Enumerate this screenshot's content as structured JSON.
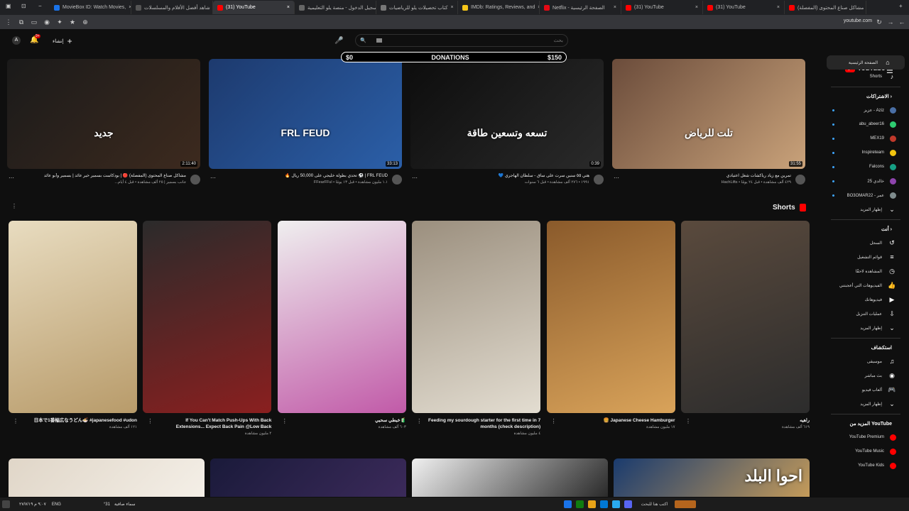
{
  "browser": {
    "tabs": [
      {
        "label": "MovieBox ID: Watch Movies,",
        "color": "#1a73e8"
      },
      {
        "label": "شاهد أفضل الأفلام والمسلسلات",
        "color": "#555"
      },
      {
        "label": "(31) YouTube",
        "color": "#f00",
        "active": true
      },
      {
        "label": "تسجيل الدخول - منصة يلو التعليمية",
        "color": "#666"
      },
      {
        "label": "كتاب تحصيلات يلو للرياضيات",
        "color": "#777"
      },
      {
        "label": "IMDb: Ratings, Reviews, and",
        "color": "#f5c518"
      },
      {
        "label": "Netflix - الصفحة الرئيسية",
        "color": "#e50914"
      },
      {
        "label": "(31) YouTube",
        "color": "#f00"
      },
      {
        "label": "(31) YouTube",
        "color": "#f00"
      },
      {
        "label": "مشاكل صناع المحتوى (المفصلة)",
        "color": "#f00"
      }
    ],
    "url": "youtube.com"
  },
  "header": {
    "avatar_letter": "A",
    "notif_count": "9+",
    "create_label": "إنشاء",
    "search_placeholder": "بحث",
    "logo": "YouTube",
    "logo_suffix": "SA"
  },
  "donations": {
    "left": "$0",
    "title": "DONATIONS",
    "right": "$150"
  },
  "sidebar": {
    "main": [
      {
        "label": "الصفحة الرئيسية",
        "icon": "home-icon",
        "glyph": "⌂",
        "selected": true
      },
      {
        "label": "Shorts",
        "icon": "shorts-icon",
        "glyph": "♪"
      }
    ],
    "subs_title": "الاشتراكات ›",
    "subs": [
      {
        "label": "عزيز - Aziz",
        "color": "#4a6fa5"
      },
      {
        "label": "abu_abeer16",
        "color": "#2ecc71"
      },
      {
        "label": "MEX19",
        "color": "#c0392b"
      },
      {
        "label": "Inspireteam",
        "color": "#f1c40f"
      },
      {
        "label": "Falcons",
        "color": "#16a085"
      },
      {
        "label": "خالدي 25",
        "color": "#8e44ad"
      },
      {
        "label": "BO3OMAR22 - عمر",
        "color": "#7f8c8d"
      }
    ],
    "subs_more": "إظهار المزيد",
    "you_title": "أنت ›",
    "you": [
      {
        "label": "السجل",
        "icon": "history-icon",
        "glyph": "↺"
      },
      {
        "label": "قوائم التشغيل",
        "icon": "playlist-icon",
        "glyph": "≡"
      },
      {
        "label": "المشاهدة لاحقًا",
        "icon": "watch-later-icon",
        "glyph": "◷"
      },
      {
        "label": "الفيديوهات التي أعجبتني",
        "icon": "like-icon",
        "glyph": "👍"
      },
      {
        "label": "فيديوهاتك",
        "icon": "your-videos-icon",
        "glyph": "▶"
      },
      {
        "label": "عمليات التنزيل",
        "icon": "download-icon",
        "glyph": "⇩"
      },
      {
        "label": "إظهار المزيد",
        "icon": "chevron-down-icon",
        "glyph": "⌄"
      }
    ],
    "explore_title": "استكشاف",
    "explore": [
      {
        "label": "موسيقى",
        "icon": "music-icon",
        "glyph": "♫"
      },
      {
        "label": "بث مباشر",
        "icon": "live-icon",
        "glyph": "◉"
      },
      {
        "label": "ألعاب فيديو",
        "icon": "gaming-icon",
        "glyph": "🎮"
      },
      {
        "label": "إظهار المزيد",
        "icon": "chevron-down-icon",
        "glyph": "⌄"
      }
    ],
    "more_title": "المزيد من YouTube",
    "more": [
      {
        "label": "YouTube Premium",
        "color": "#f00"
      },
      {
        "label": "YouTube Music",
        "color": "#f00"
      },
      {
        "label": "YouTube Kids",
        "color": "#f00"
      }
    ]
  },
  "videos": [
    {
      "title": "مشاكل صناع المحتوى (المفصلة) 🔴 | بودكاست بسمير خير عائد | بسمير وأبو عائد",
      "meta": "...جانب بسمير | ٢٥ ألف مشاهدة • قبل ٤ أيام",
      "duration": "2:11:40",
      "colors": [
        "#1a1a1a",
        "#3d2a1e"
      ],
      "overlay": "جديد"
    },
    {
      "title": "🔥 تحدي بطولة خليجي على 50,000 ريال ⚽ | FRL FEUD",
      "meta": "FFearFFul • ١.١ مليون مشاهدة • قبل ١٣ يومًا",
      "duration": "33:13",
      "colors": [
        "#1d3a6e",
        "#2b5fa8"
      ],
      "overlay": "FRL FEUD"
    },
    {
      "title": "💙 هتي ٥٥ سنين سرت على ساق - سلطان الهاجري",
      "meta": "١٩٩١ • ٢٧٦ ألف مشاهدة • قبل ٦ سنوات",
      "duration": "0:39",
      "colors": [
        "#0d0d0d",
        "#2a2a2a"
      ],
      "overlay": "تسعه وتسعين طاقة"
    },
    {
      "title": "تمرين مع زياد رياكشات شغل اعتيادي",
      "meta": "HachLifts • ٤٢٩ ألف مشاهدة • قبل ٢٤ يومًا",
      "duration": "31:55",
      "colors": [
        "#6b4c3b",
        "#c9a27a"
      ],
      "overlay": "تلت للرياض"
    }
  ],
  "shorts_title": "Shorts",
  "shorts": [
    {
      "title": "日本で1番幅広なうどん🍜 #japanesefood #udon",
      "views": "١٢١ ألف مشاهدة",
      "colors": [
        "#e8dcc0",
        "#b89b6a"
      ]
    },
    {
      "title": "If You Can't Match Push-Ups With Back Extensions... Expect Back Pain @Low Back",
      "views": "٢ مليون مشاهدة",
      "colors": [
        "#2b2b2b",
        "#8a1f1f"
      ]
    },
    {
      "title": "خبطي سحبي🧃",
      "views": "٦٠٣ ألف مشاهدة",
      "colors": [
        "#efefef",
        "#c15aa8"
      ]
    },
    {
      "title": "Feeding my sourdough starter for the first time in 7 months (check description)",
      "views": "٤ مليون مشاهدة",
      "colors": [
        "#9b8f7e",
        "#e3ddd1"
      ]
    },
    {
      "title": "🍔 Japanese Cheese Hamburger",
      "views": "١٧ مليون مشاهدة",
      "colors": [
        "#8a5a2b",
        "#d9a35a"
      ]
    },
    {
      "title": "راهيه",
      "views": "٦١٩ ألف مشاهدة",
      "colors": [
        "#5a4a3d",
        "#2c2c2c"
      ]
    }
  ],
  "row3": [
    {
      "colors": [
        "#e0d6c8",
        "#f4efe7"
      ]
    },
    {
      "colors": [
        "#1a1a3a",
        "#3b2a5a"
      ]
    },
    {
      "colors": [
        "#f0f0f0",
        "#2a2a2a"
      ]
    },
    {
      "colors": [
        "#1a3b6e",
        "#c49b5a"
      ],
      "overlay": "احوا البلد"
    }
  ],
  "taskbar": {
    "time": "٩:٠٧ م",
    "date": "٢٧/٧/١٩",
    "lang": "ENG",
    "weather": "سماء صافية",
    "temp": "°31",
    "search": "اكتب هنا للبحث"
  }
}
